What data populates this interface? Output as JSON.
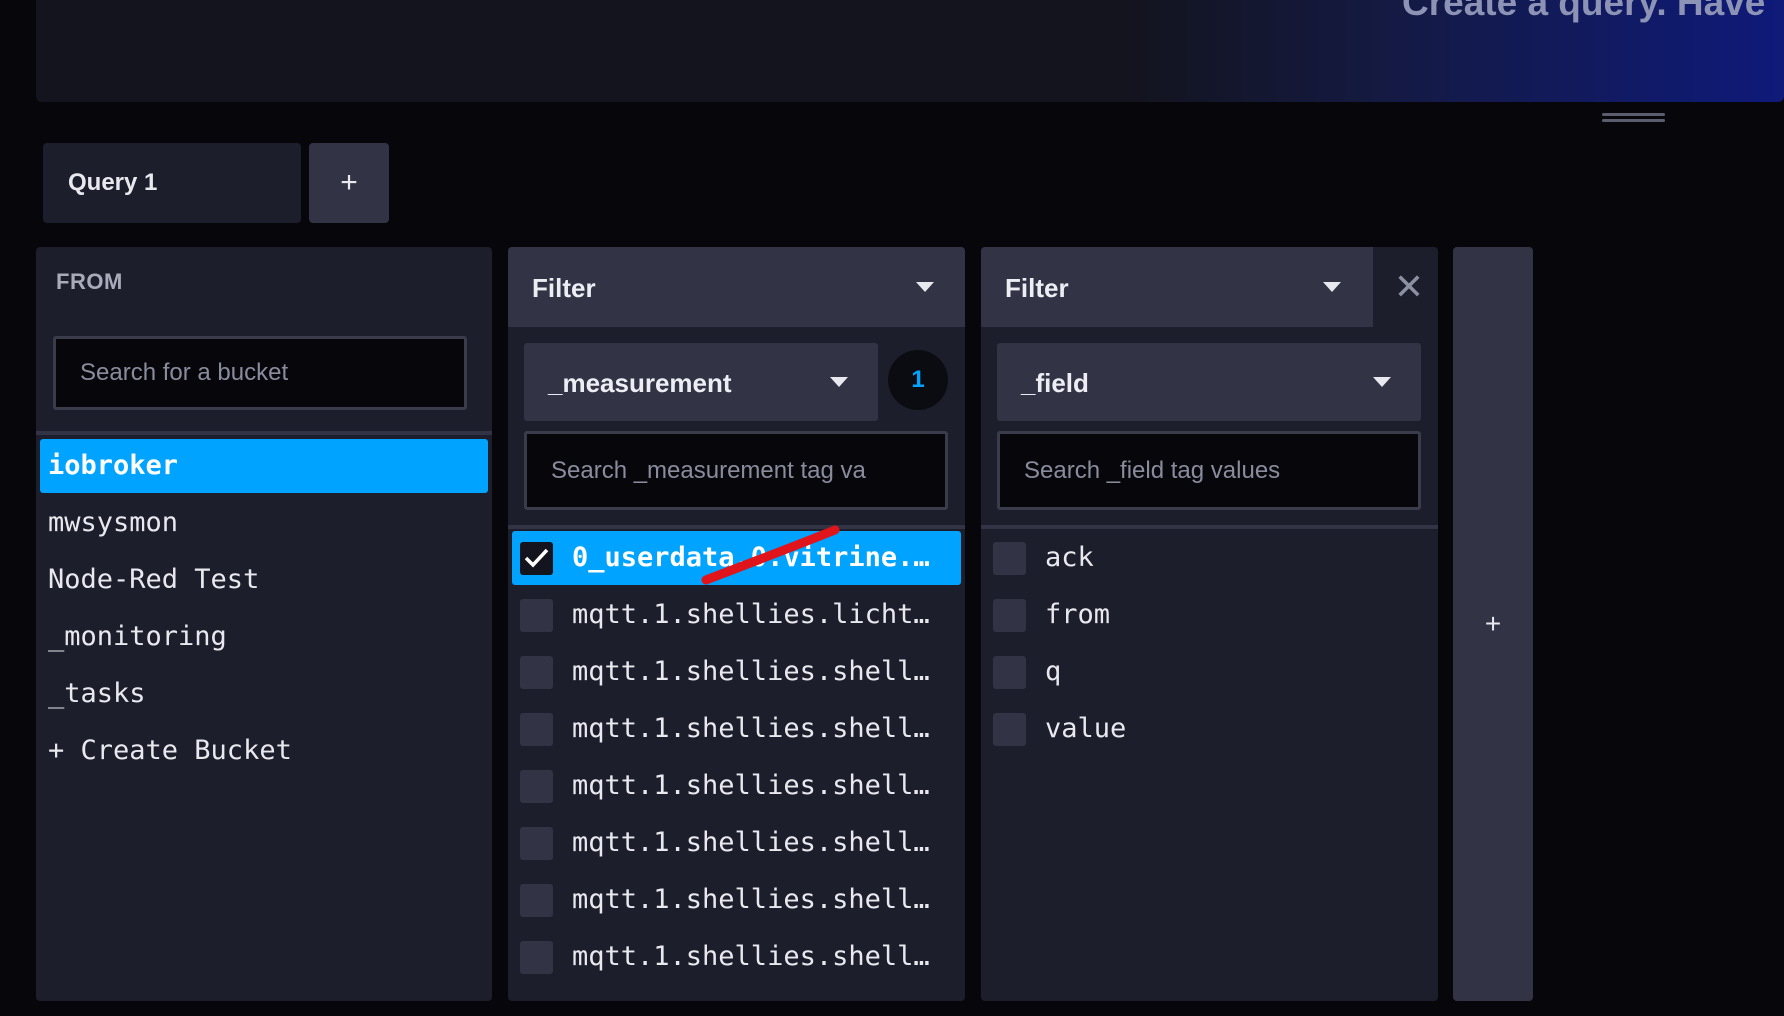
{
  "banner": {
    "text": "Create a query. Have"
  },
  "query_tabs": {
    "tab1_label": "Query 1",
    "add_label": "+"
  },
  "from_panel": {
    "heading": "FROM",
    "search_placeholder": "Search for a bucket",
    "buckets": [
      "iobroker",
      "mwsysmon",
      "Node-Red Test",
      "_monitoring",
      "_tasks",
      "+ Create Bucket"
    ],
    "selected_bucket": "iobroker"
  },
  "filter1": {
    "header": "Filter",
    "tag_key": "_measurement",
    "selected_count": "1",
    "search_placeholder": "Search _measurement tag va",
    "values": [
      {
        "label": "0_userdata.0.vitrine.…",
        "checked": true
      },
      {
        "label": "mqtt.1.shellies.licht…",
        "checked": false
      },
      {
        "label": "mqtt.1.shellies.shell…",
        "checked": false
      },
      {
        "label": "mqtt.1.shellies.shell…",
        "checked": false
      },
      {
        "label": "mqtt.1.shellies.shell…",
        "checked": false
      },
      {
        "label": "mqtt.1.shellies.shell…",
        "checked": false
      },
      {
        "label": "mqtt.1.shellies.shell…",
        "checked": false
      },
      {
        "label": "mqtt.1.shellies.shell…",
        "checked": false
      }
    ]
  },
  "filter2": {
    "header": "Filter",
    "tag_key": "_field",
    "search_placeholder": "Search _field tag values",
    "values": [
      {
        "label": "ack",
        "checked": false
      },
      {
        "label": "from",
        "checked": false
      },
      {
        "label": "q",
        "checked": false
      },
      {
        "label": "value",
        "checked": false
      }
    ]
  },
  "add_filter": {
    "label": "+"
  },
  "colors": {
    "accent": "#00a3ff",
    "panel": "#1d1e2b",
    "control": "#323445",
    "background": "#07070b",
    "annotation": "#e0141b"
  }
}
